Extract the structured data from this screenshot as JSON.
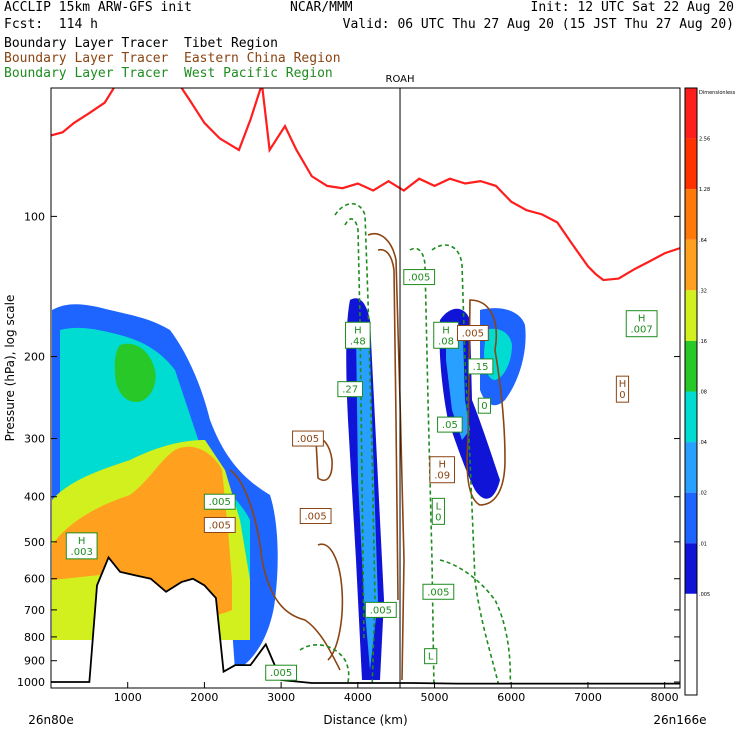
{
  "header": {
    "title_line1": "ACCLIP 15km ARW-GFS init",
    "title_line2": "Fcst:  114 h",
    "center": "NCAR/MMM",
    "init": "Init: 12 UTC Sat 22 Aug 20",
    "valid": "Valid: 06 UTC Thu 27 Aug 20 (15 JST Thu 27 Aug 20)",
    "legend": [
      {
        "label": "Boundary Layer Tracer  Tibet Region",
        "color": "#000000"
      },
      {
        "label": "Boundary Layer Tracer  Eastern China Region",
        "color": "#8b4513"
      },
      {
        "label": "Boundary Layer Tracer  West Pacific Region",
        "color": "#1e8c1e"
      }
    ]
  },
  "chart_data": {
    "type": "heatmap",
    "xlabel": "Distance (km)",
    "ylabel": "Pressure (hPa), log scale",
    "x_ticks": [
      0,
      1000,
      2000,
      3000,
      4000,
      5000,
      6000,
      7000,
      8000
    ],
    "x_tick_labels": [
      "",
      "1000",
      "2000",
      "3000",
      "4000",
      "5000",
      "6000",
      "7000",
      "8000"
    ],
    "xlim": [
      0,
      8200
    ],
    "y_scale": "log",
    "ylim": [
      1030,
      53
    ],
    "y_ticks": [
      100,
      200,
      300,
      400,
      500,
      600,
      700,
      800,
      900,
      1000
    ],
    "left_end_label": "26n80e",
    "right_end_label": "26n166e",
    "marker": {
      "label": "ROAH",
      "x": 4550
    },
    "colorbar": {
      "title": "Dimensionless",
      "colors": [
        "#ffffff",
        "#ffffff",
        "#0f14d6",
        "#1e64ff",
        "#28a0ff",
        "#00dcd2",
        "#28c828",
        "#d2f01e",
        "#ffa01e",
        "#ff780a",
        "#ff3200",
        "#ff1e1e"
      ],
      "labels": [
        ".005",
        ".01",
        ".02",
        ".04",
        ".08",
        ".16",
        ".32",
        ".64",
        "1.28",
        "2.56"
      ]
    },
    "series": [
      {
        "name": "Tibet",
        "style": "filled"
      },
      {
        "name": "Eastern China",
        "style": "contour"
      },
      {
        "name": "West Pacific",
        "style": "dashed contour"
      }
    ],
    "tropopause_line": [
      {
        "x": 0,
        "p": 67
      },
      {
        "x": 150,
        "p": 66
      },
      {
        "x": 300,
        "p": 63
      },
      {
        "x": 500,
        "p": 60
      },
      {
        "x": 700,
        "p": 57
      },
      {
        "x": 850,
        "p": 52
      },
      {
        "x": 1000,
        "p": 47
      },
      {
        "x": 1300,
        "p": 46
      },
      {
        "x": 1600,
        "p": 50
      },
      {
        "x": 1800,
        "p": 56
      },
      {
        "x": 2000,
        "p": 63
      },
      {
        "x": 2200,
        "p": 68
      },
      {
        "x": 2450,
        "p": 72
      },
      {
        "x": 2600,
        "p": 62
      },
      {
        "x": 2750,
        "p": 52
      },
      {
        "x": 2850,
        "p": 72
      },
      {
        "x": 3050,
        "p": 64
      },
      {
        "x": 3200,
        "p": 72
      },
      {
        "x": 3400,
        "p": 82
      },
      {
        "x": 3600,
        "p": 86
      },
      {
        "x": 3800,
        "p": 87
      },
      {
        "x": 4000,
        "p": 85
      },
      {
        "x": 4200,
        "p": 88
      },
      {
        "x": 4400,
        "p": 84
      },
      {
        "x": 4600,
        "p": 88
      },
      {
        "x": 4800,
        "p": 83
      },
      {
        "x": 5000,
        "p": 86
      },
      {
        "x": 5200,
        "p": 83
      },
      {
        "x": 5400,
        "p": 85
      },
      {
        "x": 5600,
        "p": 84
      },
      {
        "x": 5800,
        "p": 86
      },
      {
        "x": 6000,
        "p": 93
      },
      {
        "x": 6200,
        "p": 97
      },
      {
        "x": 6400,
        "p": 99
      },
      {
        "x": 6600,
        "p": 103
      },
      {
        "x": 6800,
        "p": 115
      },
      {
        "x": 7000,
        "p": 128
      },
      {
        "x": 7100,
        "p": 133
      },
      {
        "x": 7200,
        "p": 137
      },
      {
        "x": 7400,
        "p": 136
      },
      {
        "x": 7600,
        "p": 130
      },
      {
        "x": 7800,
        "p": 125
      },
      {
        "x": 8000,
        "p": 120
      },
      {
        "x": 8200,
        "p": 117
      }
    ],
    "terrain": [
      {
        "x": 0,
        "p": 1000
      },
      {
        "x": 500,
        "p": 1000
      },
      {
        "x": 600,
        "p": 620
      },
      {
        "x": 750,
        "p": 540
      },
      {
        "x": 900,
        "p": 580
      },
      {
        "x": 1100,
        "p": 590
      },
      {
        "x": 1300,
        "p": 600
      },
      {
        "x": 1500,
        "p": 640
      },
      {
        "x": 1700,
        "p": 610
      },
      {
        "x": 1850,
        "p": 600
      },
      {
        "x": 2000,
        "p": 620
      },
      {
        "x": 2150,
        "p": 660
      },
      {
        "x": 2250,
        "p": 950
      },
      {
        "x": 2400,
        "p": 920
      },
      {
        "x": 2600,
        "p": 920
      },
      {
        "x": 2800,
        "p": 830
      },
      {
        "x": 3000,
        "p": 990
      },
      {
        "x": 3400,
        "p": 1005
      },
      {
        "x": 4000,
        "p": 1005
      },
      {
        "x": 4700,
        "p": 1005
      },
      {
        "x": 5300,
        "p": 1008
      },
      {
        "x": 8200,
        "p": 1008
      }
    ],
    "labels": [
      {
        "text": "H\n.003",
        "x": 400,
        "p": 510,
        "color": "#1e8c1e"
      },
      {
        "text": ".005",
        "x": 2200,
        "p": 460,
        "color": "#8b4513"
      },
      {
        "text": ".005",
        "x": 2200,
        "p": 410,
        "color": "#1e8c1e"
      },
      {
        "text": ".005",
        "x": 3350,
        "p": 300,
        "color": "#8b4513"
      },
      {
        "text": ".005",
        "x": 3450,
        "p": 440,
        "color": "#8b4513"
      },
      {
        "text": ".005",
        "x": 3000,
        "p": 955,
        "color": "#1e8c1e"
      },
      {
        "text": "H\n.48",
        "x": 4000,
        "p": 180,
        "color": "#1e8c1e"
      },
      {
        "text": ".27",
        "x": 3900,
        "p": 235,
        "color": "#1e8c1e"
      },
      {
        "text": ".005",
        "x": 4800,
        "p": 135,
        "color": "#1e8c1e"
      },
      {
        "text": "H\n.08",
        "x": 5150,
        "p": 180,
        "color": "#1e8c1e"
      },
      {
        "text": ".005",
        "x": 5500,
        "p": 178,
        "color": "#8b4513"
      },
      {
        "text": ".15",
        "x": 5600,
        "p": 210,
        "color": "#1e8c1e"
      },
      {
        "text": "0",
        "x": 5650,
        "p": 255,
        "color": "#1e8c1e"
      },
      {
        "text": ".05",
        "x": 5200,
        "p": 280,
        "color": "#1e8c1e"
      },
      {
        "text": "H\n.09",
        "x": 5100,
        "p": 350,
        "color": "#8b4513"
      },
      {
        "text": "L\n0",
        "x": 5050,
        "p": 430,
        "color": "#1e8c1e"
      },
      {
        "text": "H\n.007",
        "x": 7700,
        "p": 170,
        "color": "#1e8c1e"
      },
      {
        "text": "H\n0",
        "x": 7450,
        "p": 235,
        "color": "#8b4513"
      },
      {
        "text": ".005",
        "x": 5050,
        "p": 640,
        "color": "#1e8c1e"
      },
      {
        "text": ".005",
        "x": 4300,
        "p": 700,
        "color": "#1e8c1e"
      },
      {
        "text": "L",
        "x": 4950,
        "p": 880,
        "color": "#1e8c1e"
      }
    ]
  }
}
